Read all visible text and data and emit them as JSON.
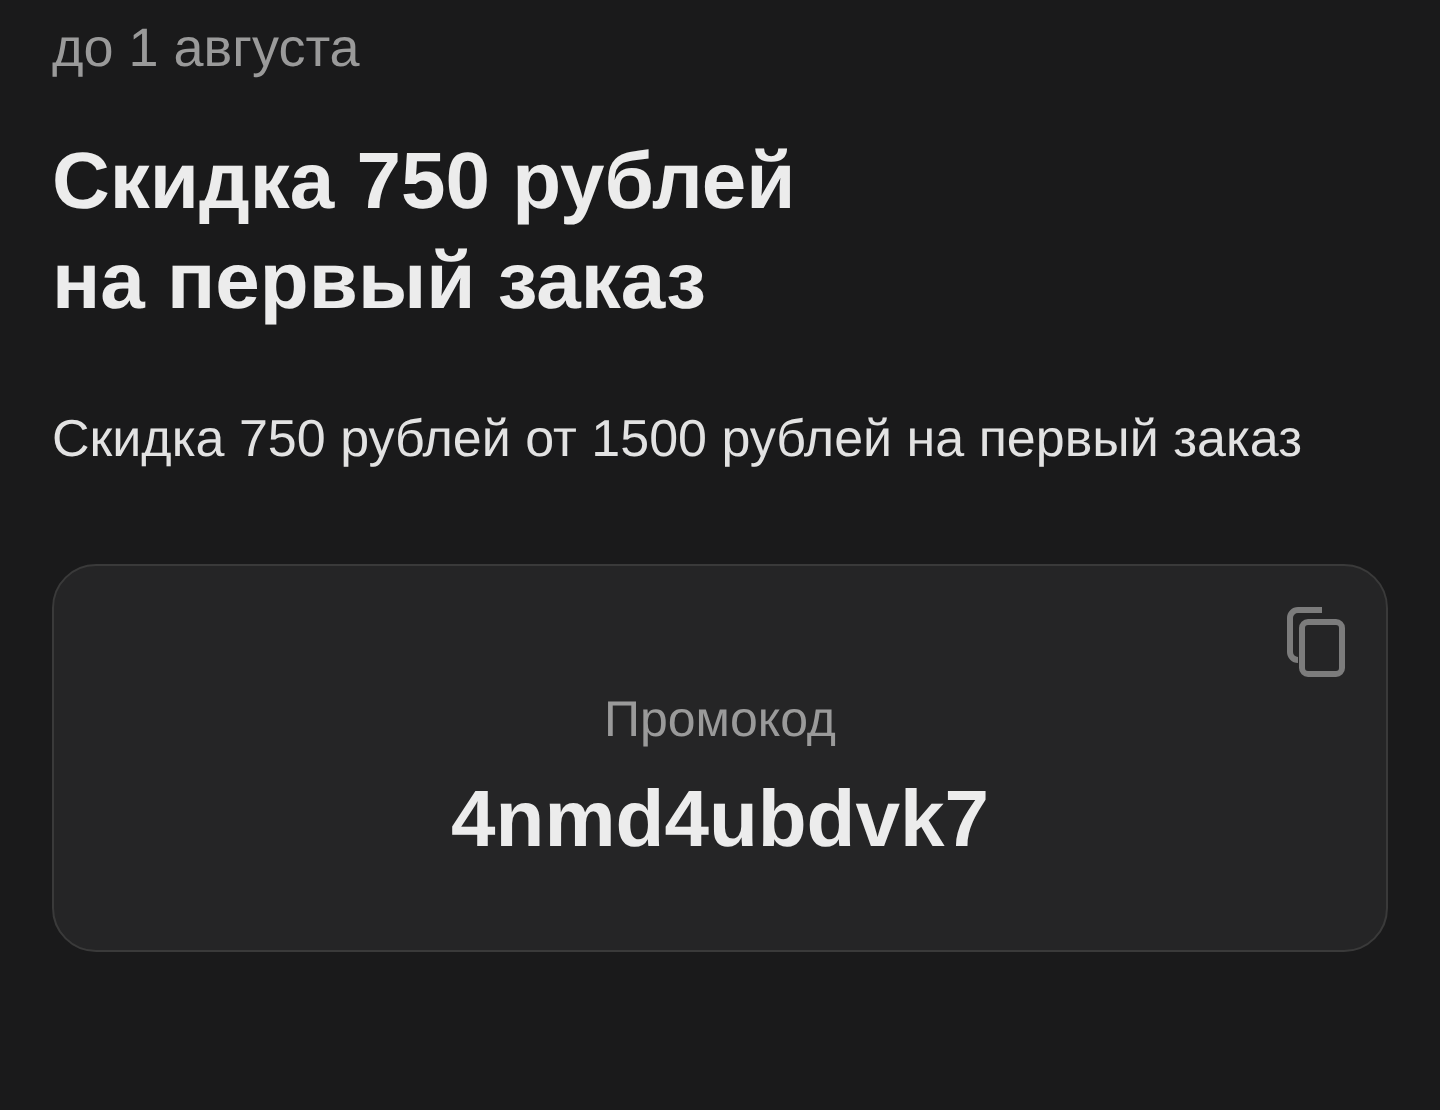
{
  "validity": "до 1 августа",
  "title_lines": [
    "Скидка 750 рублей",
    "на первый заказ"
  ],
  "description": "Скидка 750 рублей от 1500 рублей на первый заказ",
  "promo": {
    "label": "Промокод",
    "code": "4nmd4ubdvk7"
  }
}
